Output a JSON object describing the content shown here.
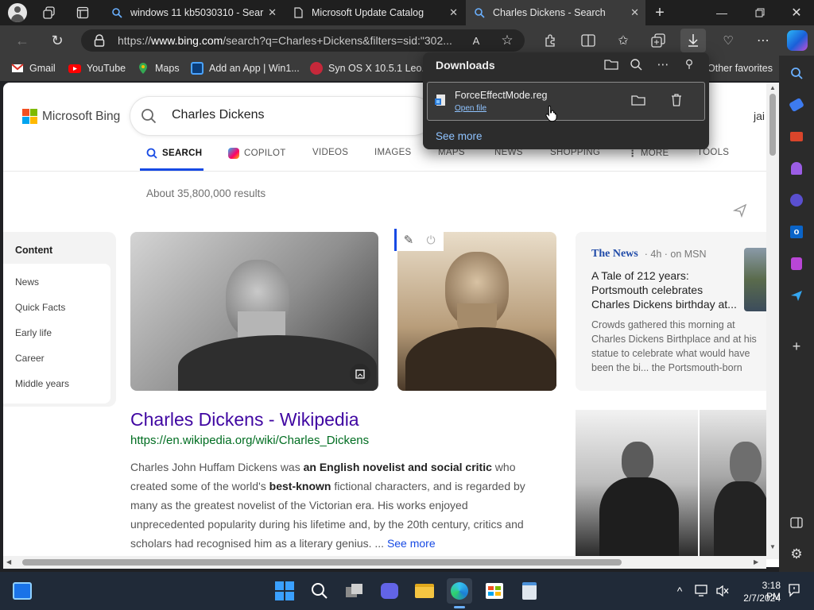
{
  "tabs": [
    {
      "title": "windows 11 kb5030310 - Sear"
    },
    {
      "title": "Microsoft Update Catalog"
    },
    {
      "title": "Charles Dickens - Search"
    }
  ],
  "address": {
    "prefix": "https://",
    "host": "www.bing.com",
    "rest": "/search?q=Charles+Dickens&filters=sid:\"302..."
  },
  "favorites": [
    {
      "label": "Gmail"
    },
    {
      "label": "YouTube"
    },
    {
      "label": "Maps"
    },
    {
      "label": "Add an App | Win1..."
    },
    {
      "label": "Syn OS X 10.5.1 Leo..."
    }
  ],
  "favorites_other": "Other favorites",
  "downloads": {
    "title": "Downloads",
    "file": "ForceEffectMode.reg",
    "open": "Open file",
    "see_more": "See more"
  },
  "bing": {
    "logo": "Microsoft Bing",
    "query": "Charles Dickens",
    "user_partial": "jai",
    "tabs": [
      "SEARCH",
      "COPILOT",
      "VIDEOS",
      "IMAGES",
      "MAPS",
      "NEWS",
      "SHOPPING",
      "MORE",
      "TOOLS"
    ],
    "results_count": "About 35,800,000 results",
    "toc_title": "Content",
    "toc": [
      "News",
      "Quick Facts",
      "Early life",
      "Career",
      "Middle years"
    ],
    "result": {
      "title": "Charles Dickens - Wikipedia",
      "url": "https://en.wikipedia.org/wiki/Charles_Dickens",
      "s1": "Charles John Huffam Dickens was ",
      "b1": "an English novelist and social critic",
      "s2": " who",
      "s3": "created some of the world's ",
      "b2": "best-known",
      "s4": " fictional characters, and is regarded by",
      "s5": "many as the greatest novelist of the Victorian era. His works enjoyed",
      "s6": "unprecedented popularity during his lifetime and, by the 20th century, critics and",
      "s7": "scholars had recognised him as a literary genius. ...",
      "more": "See more"
    },
    "news": {
      "source": "The News",
      "age": "4h",
      "via": "on MSN",
      "headline": "A Tale of 212 years: Portsmouth celebrates Charles Dickens birthday at...",
      "snippet": "Crowds gathered this morning at Charles Dickens Birthplace and at his statue to celebrate what would have been the bi... the Portsmouth-born writer."
    }
  },
  "clock": {
    "time": "3:18 PM",
    "date": "2/7/2024"
  },
  "colors": {
    "bing_blue": "#174ae4",
    "link_purple": "#4007a2",
    "url_green": "#006d21",
    "edge_dark": "#3b3b3b"
  }
}
